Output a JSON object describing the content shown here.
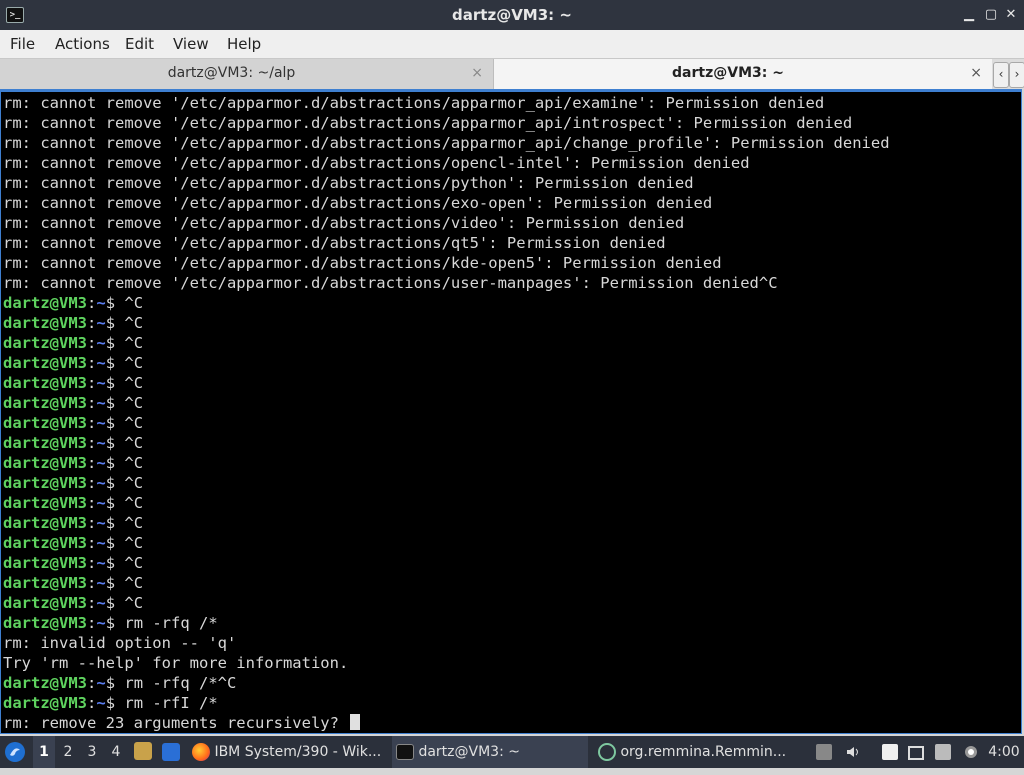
{
  "window": {
    "title": "dartz@VM3: ~",
    "controls": {
      "minimize": "▁",
      "maximize": "▢",
      "close": "✕"
    }
  },
  "menu": [
    "File",
    "Actions",
    "Edit",
    "View",
    "Help"
  ],
  "tabs": [
    {
      "label": "dartz@VM3: ~/alp",
      "active": false,
      "close": "×"
    },
    {
      "label": "dartz@VM3: ~",
      "active": true,
      "close": "×"
    }
  ],
  "tab_nav": {
    "prev": "‹",
    "next": "›"
  },
  "terminal": {
    "prompt": {
      "user": "dartz@VM3",
      "sep": ":",
      "path": "~",
      "sym": "$ "
    },
    "lines": [
      {
        "text": "rm: cannot remove '/etc/apparmor.d/abstractions/apparmor_api/examine': Permission denied"
      },
      {
        "text": "rm: cannot remove '/etc/apparmor.d/abstractions/apparmor_api/introspect': Permission denied"
      },
      {
        "text": "rm: cannot remove '/etc/apparmor.d/abstractions/apparmor_api/change_profile': Permission denied"
      },
      {
        "text": "rm: cannot remove '/etc/apparmor.d/abstractions/opencl-intel': Permission denied"
      },
      {
        "text": "rm: cannot remove '/etc/apparmor.d/abstractions/python': Permission denied"
      },
      {
        "text": "rm: cannot remove '/etc/apparmor.d/abstractions/exo-open': Permission denied"
      },
      {
        "text": "rm: cannot remove '/etc/apparmor.d/abstractions/video': Permission denied"
      },
      {
        "text": "rm: cannot remove '/etc/apparmor.d/abstractions/qt5': Permission denied"
      },
      {
        "text": "rm: cannot remove '/etc/apparmor.d/abstractions/kde-open5': Permission denied"
      },
      {
        "text": "rm: cannot remove '/etc/apparmor.d/abstractions/user-manpages': Permission denied^C"
      },
      {
        "prompt": true,
        "cmd": "^C"
      },
      {
        "prompt": true,
        "cmd": "^C"
      },
      {
        "prompt": true,
        "cmd": "^C"
      },
      {
        "prompt": true,
        "cmd": "^C"
      },
      {
        "prompt": true,
        "cmd": "^C"
      },
      {
        "prompt": true,
        "cmd": "^C"
      },
      {
        "prompt": true,
        "cmd": "^C"
      },
      {
        "prompt": true,
        "cmd": "^C"
      },
      {
        "prompt": true,
        "cmd": "^C"
      },
      {
        "prompt": true,
        "cmd": "^C"
      },
      {
        "prompt": true,
        "cmd": "^C"
      },
      {
        "prompt": true,
        "cmd": "^C"
      },
      {
        "prompt": true,
        "cmd": "^C"
      },
      {
        "prompt": true,
        "cmd": "^C"
      },
      {
        "prompt": true,
        "cmd": "^C"
      },
      {
        "prompt": true,
        "cmd": "^C"
      },
      {
        "prompt": true,
        "cmd": "rm -rfq /*"
      },
      {
        "text": "rm: invalid option -- 'q'"
      },
      {
        "text": "Try 'rm --help' for more information."
      },
      {
        "prompt": true,
        "cmd": "rm -rfq /*^C"
      },
      {
        "prompt": true,
        "cmd": "rm -rfI /*"
      },
      {
        "text": "rm: remove 23 arguments recursively? ",
        "cursor": true
      }
    ]
  },
  "taskbar": {
    "workspaces": [
      "1",
      "2",
      "3",
      "4"
    ],
    "active_workspace": "1",
    "tasks": [
      {
        "label": "IBM System/390 - Wik...",
        "icon": "firefox-icon",
        "active": false
      },
      {
        "label": "dartz@VM3: ~",
        "icon": "terminal-icon",
        "active": true
      },
      {
        "label": "org.remmina.Remmin...",
        "icon": "remmina-icon",
        "active": false
      }
    ],
    "clock": "4:00"
  },
  "colors": {
    "titlebar": "#2f343f",
    "terminal_bg": "#000000",
    "terminal_fg": "#d8d8d8",
    "prompt_user": "#5fd35f",
    "prompt_path": "#5b7ff3",
    "taskbar": "#2b303b"
  }
}
